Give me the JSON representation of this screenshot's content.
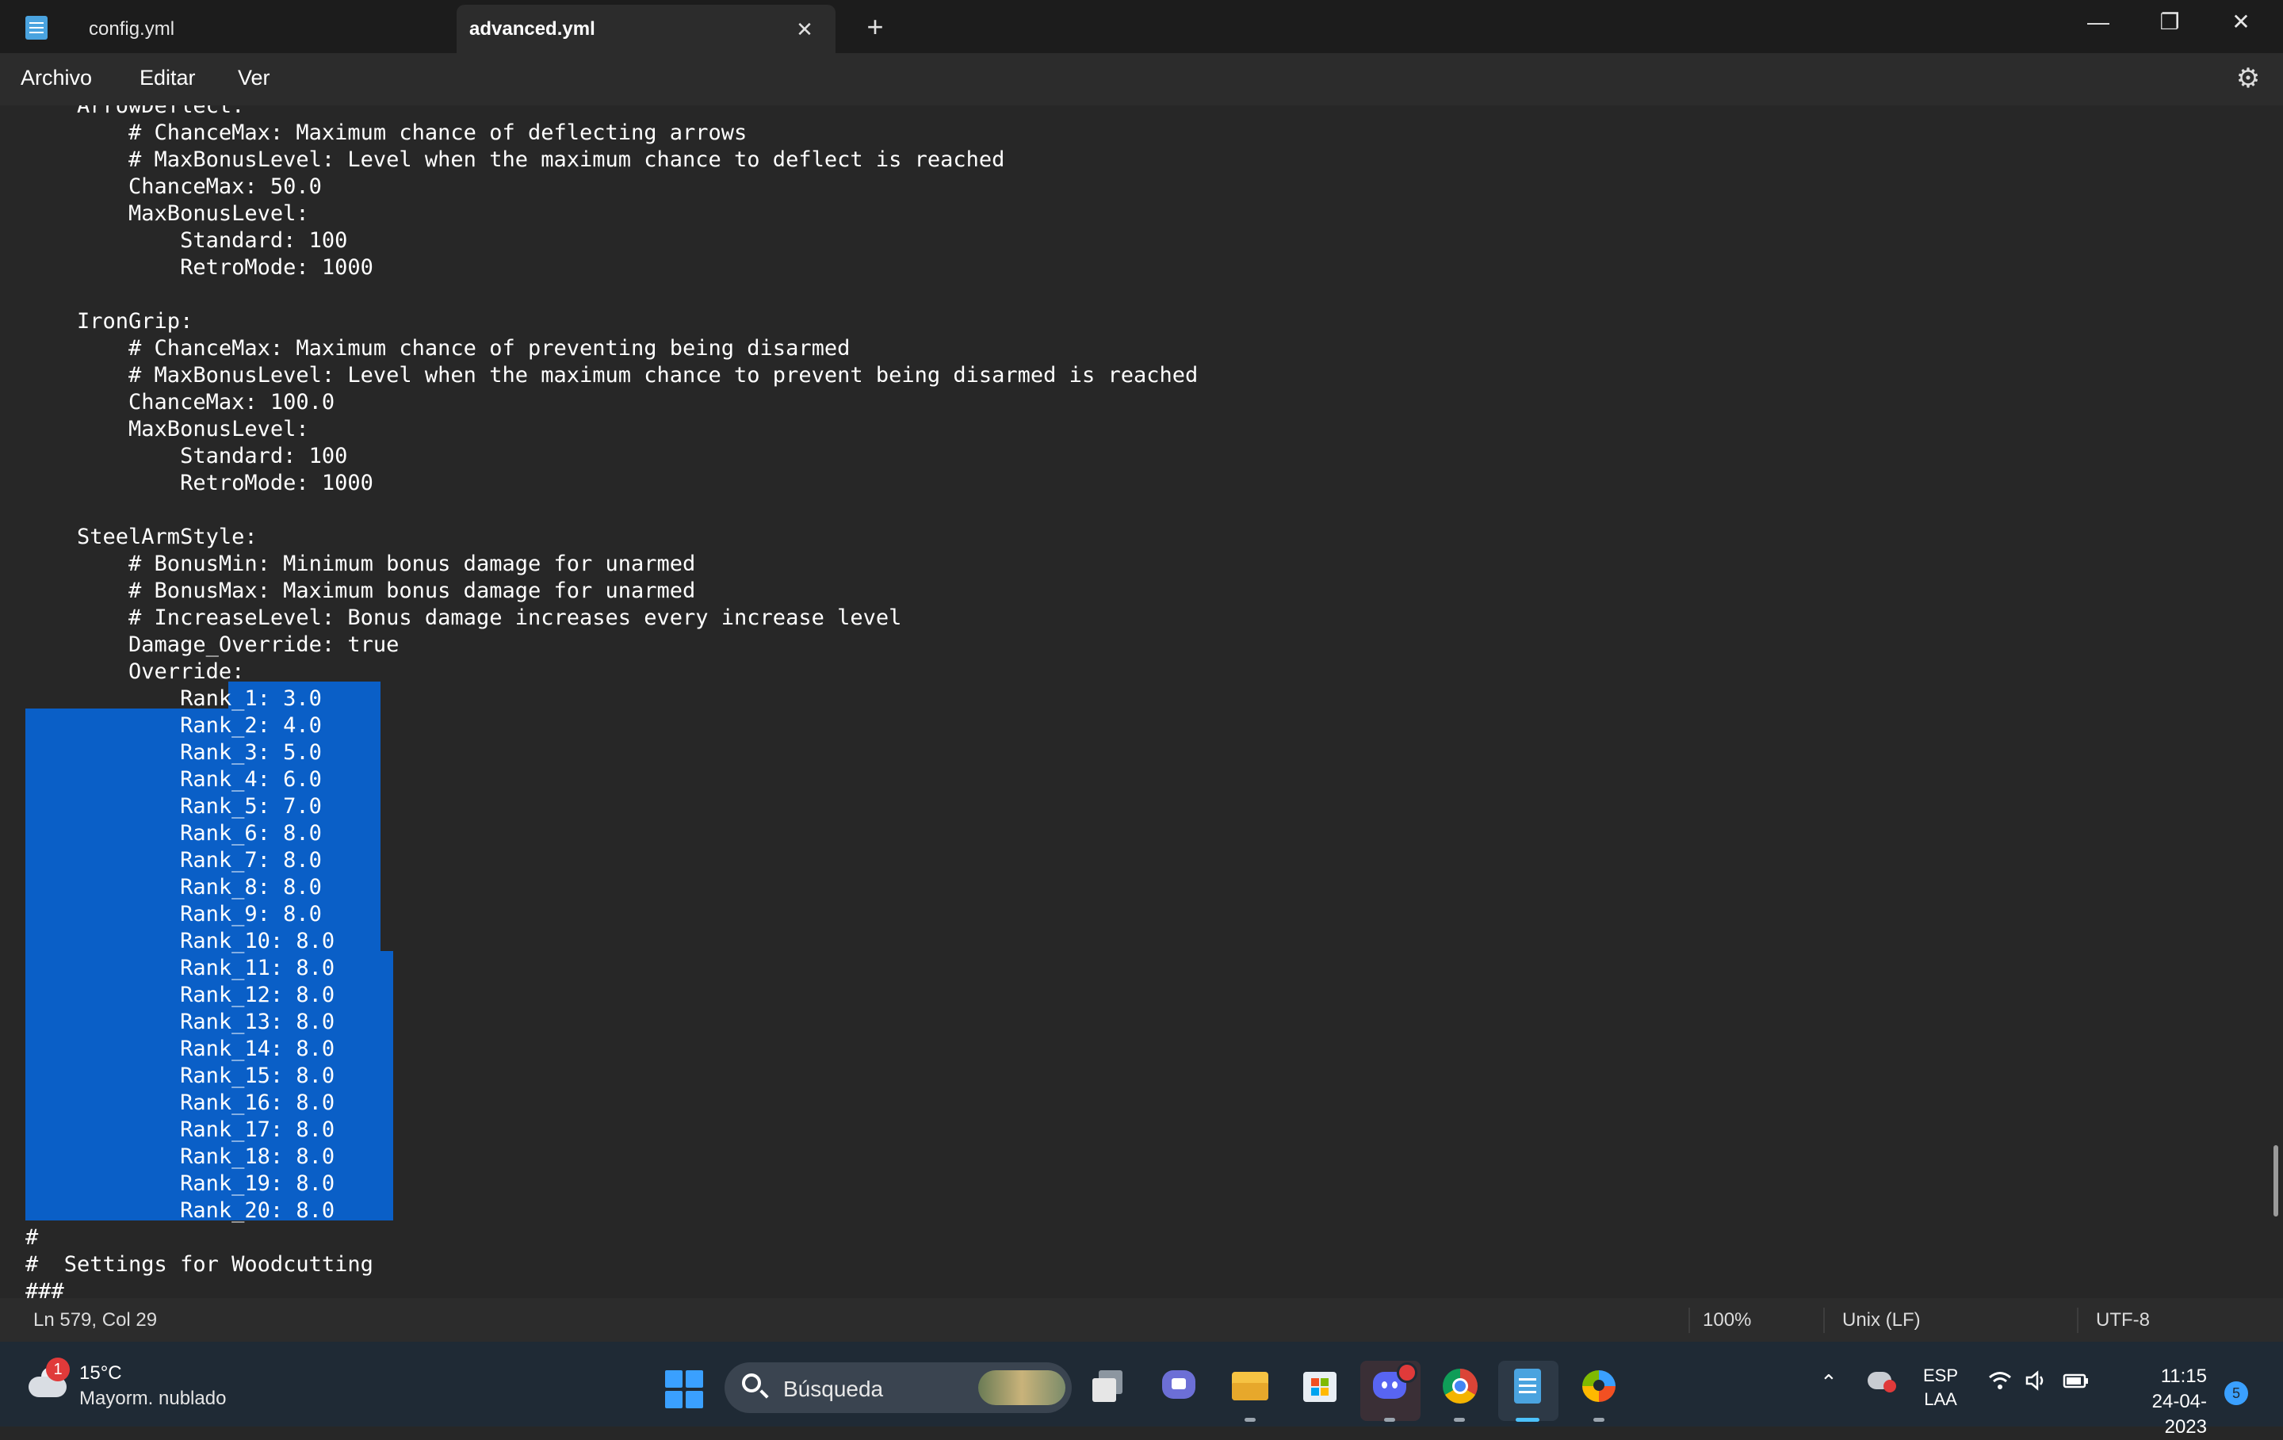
{
  "tabs": [
    {
      "label": "config.yml",
      "active": false
    },
    {
      "label": "advanced.yml",
      "active": true
    }
  ],
  "icons": {
    "new_tab": "+",
    "close_tab": "✕",
    "minimize": "—",
    "maximize": "❐",
    "close_window": "✕",
    "settings": "⚙"
  },
  "menu": [
    "Archivo",
    "Editar",
    "Ver"
  ],
  "editor": {
    "lines": [
      "    ArrowDeflect:",
      "        # ChanceMax: Maximum chance of deflecting arrows",
      "        # MaxBonusLevel: Level when the maximum chance to deflect is reached",
      "        ChanceMax: 50.0",
      "        MaxBonusLevel:",
      "            Standard: 100",
      "            RetroMode: 1000",
      "",
      "    IronGrip:",
      "        # ChanceMax: Maximum chance of preventing being disarmed",
      "        # MaxBonusLevel: Level when the maximum chance to prevent being disarmed is reached",
      "        ChanceMax: 100.0",
      "        MaxBonusLevel:",
      "            Standard: 100",
      "            RetroMode: 1000",
      "",
      "    SteelArmStyle:",
      "        # BonusMin: Minimum bonus damage for unarmed",
      "        # BonusMax: Maximum bonus damage for unarmed",
      "        # IncreaseLevel: Bonus damage increases every increase level",
      "        Damage_Override: true",
      "        Override:",
      "            Rank_1: 3.0",
      "            Rank_2: 4.0",
      "            Rank_3: 5.0",
      "            Rank_4: 6.0",
      "            Rank_5: 7.0",
      "            Rank_6: 8.0",
      "            Rank_7: 8.0",
      "            Rank_8: 8.0",
      "            Rank_9: 8.0",
      "            Rank_10: 8.0",
      "            Rank_11: 8.0",
      "            Rank_12: 8.0",
      "            Rank_13: 8.0",
      "            Rank_14: 8.0",
      "            Rank_15: 8.0",
      "            Rank_16: 8.0",
      "            Rank_17: 8.0",
      "            Rank_18: 8.0",
      "            Rank_19: 8.0",
      "            Rank_20: 8.0",
      "#",
      "#  Settings for Woodcutting",
      "###"
    ]
  },
  "status": {
    "position": "Ln 579, Col 29",
    "zoom": "100%",
    "line_ending": "Unix (LF)",
    "encoding": "UTF-8"
  },
  "taskbar": {
    "weather_badge": "1",
    "weather_temp": "15°C",
    "weather_desc": "Mayorm. nublado",
    "search_placeholder": "Búsqueda",
    "lang_primary": "ESP",
    "lang_secondary": "LAA",
    "time": "11:15",
    "date": "24-04-2023",
    "notification_count": "5"
  },
  "colors": {
    "selection": "#0a5fc7",
    "accent": "#3aa0ff"
  }
}
